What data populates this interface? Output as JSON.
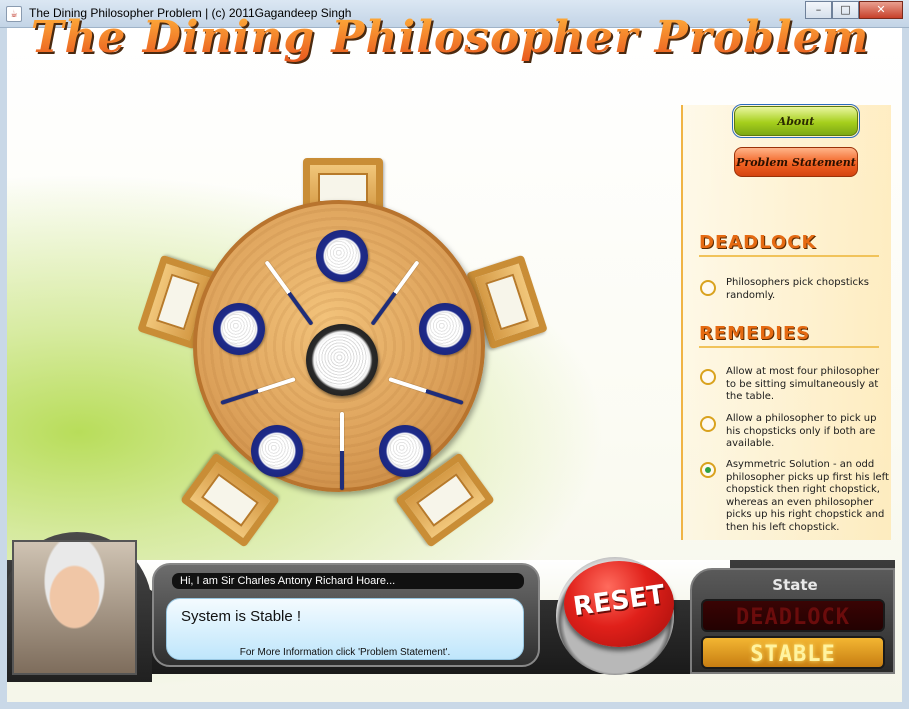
{
  "window": {
    "title": "The Dining Philosopher Problem | (c) 2011Gagandeep Singh",
    "app_icon": "java-icon",
    "controls": {
      "minimize": "–",
      "maximize": "□",
      "close": "✕"
    }
  },
  "header": {
    "title": "The Dining Philosopher Problem"
  },
  "side_panel": {
    "about_label": "About",
    "problem_statement_label": "Problem Statement",
    "deadlock_heading": "DEADLOCK",
    "deadlock_options": [
      {
        "text": "Philosophers pick chopsticks randomly.",
        "selected": false
      }
    ],
    "remedies_heading": "REMEDIES",
    "remedy_options": [
      {
        "text": "Allow at most four philosopher to be sitting simultaneously at the table.",
        "selected": false
      },
      {
        "text": "Allow a philosopher to pick up his chopsticks only if both are available.",
        "selected": false
      },
      {
        "text": "Asymmetric Solution - an odd philosopher picks up first his left chopstick then right chopstick, whereas an even philosopher picks up his right chopstick and then his left chopstick.",
        "selected": true
      }
    ]
  },
  "table": {
    "chairs": 5,
    "plates": 5,
    "chopsticks": 5
  },
  "bottom": {
    "speaker": "Hi, I am Sir Charles Antony Richard Hoare...",
    "status_message": "System is Stable !",
    "info_message": "For More Information click 'Problem Statement'.",
    "reset_label": "RESET",
    "state_label": "State",
    "deadlock_lamp": "DEADLOCK",
    "stable_lamp": "STABLE"
  },
  "colors": {
    "title_orange": "#e8561d",
    "about_green": "#a6cf1c",
    "problem_orange": "#f26222",
    "section_orange": "#e56a12",
    "reset_red": "#e0201a",
    "stable_amber": "#f3b632"
  }
}
